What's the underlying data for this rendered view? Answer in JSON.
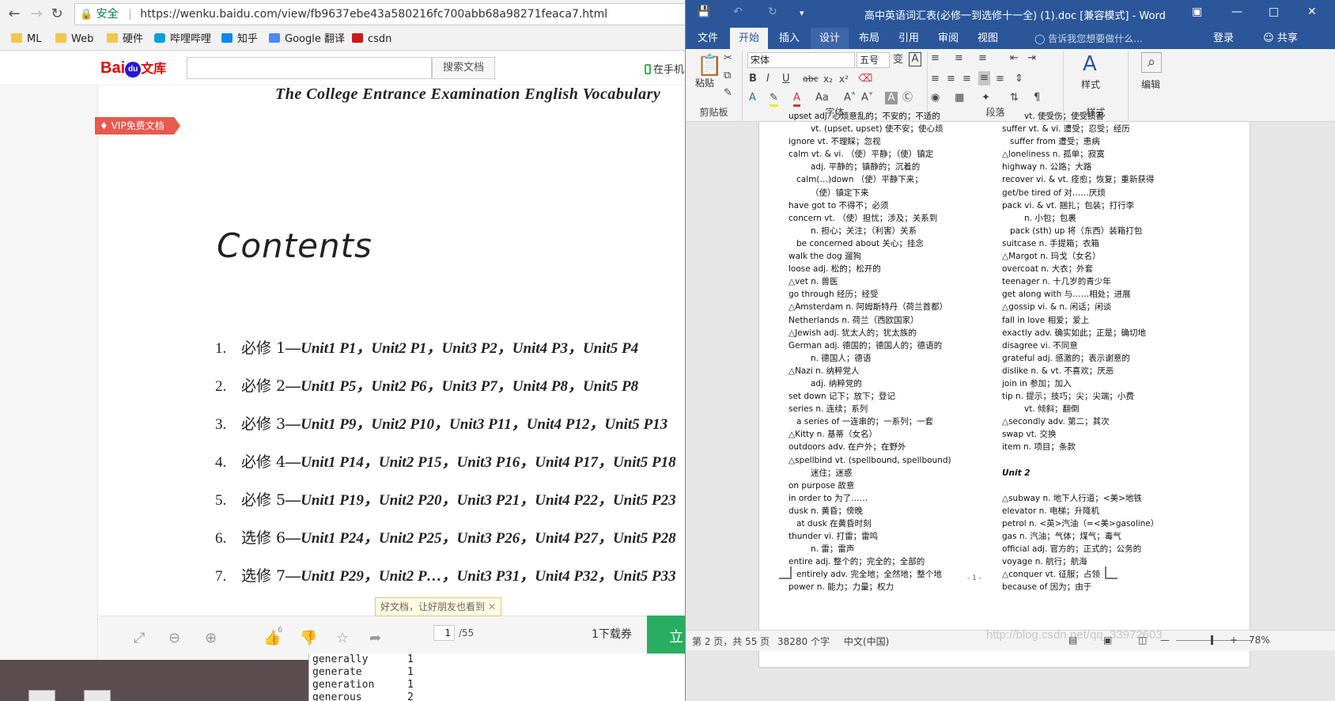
{
  "browser": {
    "security_label": "安全",
    "url": "https://wenku.baidu.com/view/fb9637ebe43a580216fc700abb68a98271feaca7.html",
    "bookmarks": [
      "ML",
      "Web",
      "硬件",
      "哔哩哔哩",
      "知乎",
      "Google 翻译",
      "csdn"
    ]
  },
  "wenku": {
    "logo": "Bai",
    "logo_du": "du",
    "logo_wk": "文库",
    "search_button": "搜索文档",
    "phone_link": "在手机",
    "vip_badge": "VIP免费文档",
    "doc_header": "The  College  Entrance  Examination  English  Vocabulary",
    "contents_title": "Contents",
    "toc": [
      {
        "num": "1.",
        "ch": "必修 1",
        "units": "—Unit1 P1，Unit2 P1，Unit3 P2，Unit4 P3，Unit5 P4"
      },
      {
        "num": "2.",
        "ch": "必修 2",
        "units": "—Unit1 P5，Unit2 P6，Unit3 P7，Unit4 P8，Unit5 P8"
      },
      {
        "num": "3.",
        "ch": "必修 3",
        "units": "—Unit1 P9，Unit2 P10，Unit3 P11，Unit4 P12，Unit5 P13"
      },
      {
        "num": "4.",
        "ch": "必修 4",
        "units": "—Unit1 P14，Unit2 P15，Unit3 P16，Unit4 P17，Unit5 P18"
      },
      {
        "num": "5.",
        "ch": "必修 5",
        "units": "—Unit1 P19，Unit2 P20，Unit3 P21，Unit4 P22，Unit5 P23"
      },
      {
        "num": "6.",
        "ch": "选修 6",
        "units": "—Unit1 P24，Unit2 P25，Unit3 P26，Unit4 P27，Unit5 P28"
      },
      {
        "num": "7.",
        "ch": "选修 7",
        "units": "—Unit1 P29，Unit2 P…，Unit3 P31，Unit4 P32，Unit5 P33"
      }
    ],
    "tooltip": "好文档，让好朋友也看到",
    "like_count": "6",
    "page_current": "1",
    "page_total": "/55",
    "download_count": "1下载券",
    "download_button": "立"
  },
  "terminal": {
    "rows": [
      {
        "word": "generally",
        "count": "1"
      },
      {
        "word": "generate",
        "count": "1"
      },
      {
        "word": "generation",
        "count": "1"
      },
      {
        "word": "generous",
        "count": "2"
      }
    ]
  },
  "word": {
    "title": "高中英语词汇表(必修一到选修十一全) (1).doc [兼容模式] - Word",
    "tabs": [
      "文件",
      "开始",
      "插入",
      "设计",
      "布局",
      "引用",
      "审阅",
      "视图"
    ],
    "tell_me": "告诉我您想要做什么...",
    "login": "登录",
    "share": "共享",
    "ribbon": {
      "paste": "粘贴",
      "clipboard": "剪贴板",
      "font_name": "宋体",
      "font_size": "五号",
      "font_group": "字体",
      "paragraph_group": "段落",
      "styles": "样式",
      "styles_group": "样式",
      "edit": "编辑"
    },
    "left_column": [
      "upset adj. 心烦意乱的；不安的；不适的",
      "vt. (upset, upset) 使不安；使心烦",
      "ignore vt. 不理睬；忽视",
      "calm vt. & vi. （使）平静；（使）镇定",
      "adj. 平静的；镇静的；沉着的",
      "calm(…)down （使）平静下来；",
      "（使）镇定下来",
      "have got to 不得不；必须",
      "concern vt. （使）担忧；涉及；关系到",
      "n. 担心；关注；（利害）关系",
      "be concerned about 关心；挂念",
      "walk the dog 遛狗",
      "loose adj. 松的；松开的",
      "△vet n. 兽医",
      "go through 经历；经受",
      "△Amsterdam n. 阿姆斯特丹（荷兰首都）",
      "Netherlands n. 荷兰（西欧国家）",
      "△Jewish adj. 犹太人的；犹太族的",
      "German adj. 德国的；德国人的；德语的",
      "n. 德国人；德语",
      "△Nazi n. 纳粹党人",
      "adj. 纳粹党的",
      "set down 记下；放下；登记",
      "series n. 连续；系列",
      "a series of 一连串的；一系列；一套",
      "△Kitty n. 基蒂（女名）",
      "outdoors adv. 在户外；在野外",
      "△spellbind vt. (spellbound, spellbound)",
      "迷住；迷惑",
      "on purpose 故意",
      "in order to 为了……",
      "dusk n. 黄昏；傍晚",
      "at dusk 在黄昏时刻",
      "thunder vi. 打雷；雷鸣",
      "n. 雷；雷声",
      "entire adj. 整个的；完全的；全部的",
      "entirely adv. 完全地；全然地；整个地",
      "power n. 能力；力量；权力"
    ],
    "right_column": [
      "vt. 使受伤；使受损害",
      "suffer vt. & vi. 遭受；忍受；经历",
      "suffer from 遭受；患病",
      "△loneliness n. 孤单；寂寞",
      "highway n. 公路；大路",
      "recover vi. & vt. 痊愈；恢复；重新获得",
      "get/be tired of 对……厌烦",
      "pack vi. & vt. 捆扎；包装；打行李",
      "n. 小包；包裹",
      "pack (sth) up 将（东西）装箱打包",
      "suitcase n. 手提箱；衣箱",
      "△Margot n. 玛戈（女名）",
      "overcoat n. 大衣；外套",
      "teenager n. 十几岁的青少年",
      "get along with 与……相处；进展",
      "△gossip vi. & n. 闲话；闲谈",
      "fall in love 相爱；爱上",
      "exactly adv. 确实如此；正是；确切地",
      "disagree vi. 不同意",
      "grateful adj. 感激的；表示谢意的",
      "dislike n. & vt. 不喜欢；厌恶",
      "join in 参加；加入",
      "tip n. 提示；技巧；尖；尖端；小费",
      "vt. 倾斜；翻倒",
      "△secondly adv. 第二；其次",
      "swap vt. 交换",
      "item n. 项目；条款",
      "",
      "Unit 2",
      "",
      "△subway n. 地下人行道；<美>地铁",
      "elevator n. 电梯；升降机",
      "petrol n. <英>汽油（=<美>gasoline）",
      "gas n. 汽油；气体；煤气；毒气",
      "official adj. 官方的；正式的；公务的",
      "voyage n. 航行；航海",
      "△conquer vt. 征服；占领",
      "because of 因为；由于"
    ],
    "page_footer": "- 1 -",
    "status": {
      "page": "第 2 页，共 55 页",
      "words": "38280 个字",
      "language": "中文(中国)",
      "zoom": "78%"
    },
    "watermark": "http://blog.csdn.net/qq_33972603"
  }
}
